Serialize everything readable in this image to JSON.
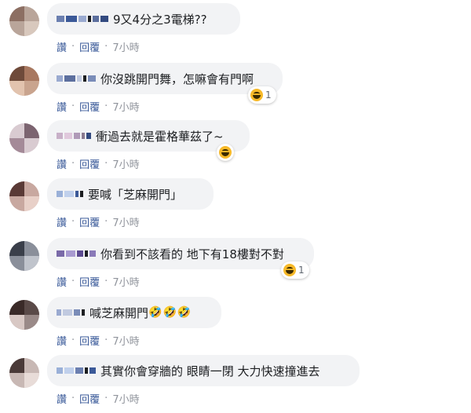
{
  "actions": {
    "like": "讚",
    "reply": "回覆",
    "sep": "·"
  },
  "comments": [
    {
      "text": "9又4分之3電梯??",
      "time": "7小時",
      "reaction_count": ""
    },
    {
      "text": "你沒跳開門舞，怎嘛會有門啊",
      "time": "7小時",
      "reaction_count": "1"
    },
    {
      "text": "衝過去就是霍格華茲了~",
      "time": "7小時",
      "reaction_count": ""
    },
    {
      "text": "要喊「芝麻開門」",
      "time": "7小時",
      "reaction_count": ""
    },
    {
      "text": "你看到不該看的 地下有18樓對不對",
      "time": "7小時",
      "reaction_count": "1"
    },
    {
      "text": "喊芝麻開門",
      "emojis": "🤣🤣🤣",
      "time": "7小時",
      "reaction_count": ""
    },
    {
      "text": "其實你會穿牆的 眼睛一閉 大力快速撞進去",
      "time": "7小時",
      "reaction_count": ""
    }
  ],
  "colors": {
    "link": "#385898",
    "bubble": "#f2f3f5",
    "meta": "#90949c",
    "haha": "#f7b928"
  },
  "icons": {
    "reaction": "haha-emoji-icon",
    "avatar": "pixelated-avatar"
  }
}
